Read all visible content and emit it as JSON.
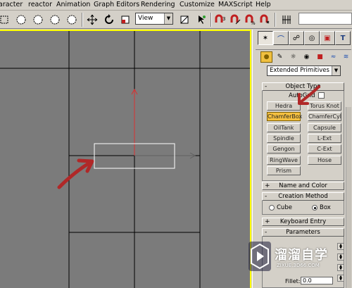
{
  "menubar": {
    "items": [
      "aracter",
      "reactor",
      "Animation",
      "Graph Editors",
      "Rendering",
      "Customize",
      "MAXScript",
      "Help"
    ]
  },
  "toolbar": {
    "view_select": "View",
    "icons": [
      "select-region-icon",
      "circle-icon",
      "circle-icon",
      "circle-icon",
      "circle-icon",
      "select-by-name-icon",
      "move-icon",
      "rotate-icon",
      "scale-icon",
      "mirror-icon",
      "snap-icon",
      "angle-snap-icon",
      "percent-snap-icon",
      "spinner-snap-icon",
      "edit-named-icon"
    ]
  },
  "command_panel": {
    "tabs": [
      "create-tab",
      "modify-tab",
      "hierarchy-tab",
      "motion-tab",
      "display-tab",
      "utilities-tab"
    ],
    "tab_glyphs": [
      "✶",
      "⌒",
      "☍",
      "◎",
      "▣",
      "T"
    ],
    "category_glyphs": [
      "●",
      "✎",
      "☼",
      "◉",
      "■",
      "≈",
      "≋"
    ],
    "subcategory": "Extended Primitives",
    "object_type": {
      "title": "Object Type",
      "autogrid_label": "AutoGrid",
      "buttons": [
        "Hedra",
        "Torus Knot",
        "ChamferBox",
        "ChamferCyl",
        "OilTank",
        "Capsule",
        "Spindle",
        "L-Ext",
        "Gengon",
        "C-Ext",
        "RingWave",
        "Hose",
        "Prism"
      ],
      "active": "ChamferBox"
    },
    "name_and_color": {
      "title": "Name and Color",
      "sign": "+"
    },
    "creation_method": {
      "title": "Creation Method",
      "sign": "-",
      "options": [
        "Cube",
        "Box"
      ],
      "selected": "Box"
    },
    "keyboard_entry": {
      "title": "Keyboard Entry",
      "sign": "+"
    },
    "parameters": {
      "title": "Parameters",
      "sign": "-",
      "fillet_label": "Fillet:",
      "fillet_value": "0.0"
    }
  },
  "watermark": {
    "text": "溜溜自学",
    "sub": "ZIXUE.3D66.COM"
  },
  "colors": {
    "active_button": "#f5c040",
    "viewport_bg": "#7b7b7b",
    "annotation_arrow": "#b02828",
    "axis_y": "#d83030"
  }
}
